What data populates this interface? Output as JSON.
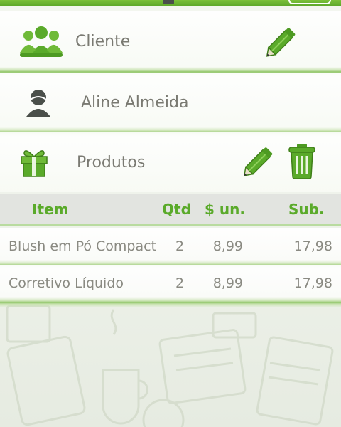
{
  "icons": {
    "customer": "customers-group-icon",
    "person": "person-icon",
    "products": "gift-icon",
    "edit": "pencil-icon",
    "delete": "trash-icon"
  },
  "colors": {
    "accent": "#5aaa2a",
    "text": "#7a7a72"
  },
  "customer_section": {
    "label": "Cliente"
  },
  "customer_name": {
    "value": "Aline Almeida"
  },
  "products_section": {
    "label": "Produtos"
  },
  "items_table": {
    "headers": {
      "item": "Item",
      "qty": "Qtd",
      "unit_price": "$ un.",
      "subtotal": "Sub."
    },
    "rows": [
      {
        "item": "Blush em Pó Compacto",
        "qty": "2",
        "unit_price": "8,99",
        "subtotal": "17,98"
      },
      {
        "item": "Corretivo Líquido",
        "qty": "2",
        "unit_price": "8,99",
        "subtotal": "17,98"
      }
    ]
  }
}
